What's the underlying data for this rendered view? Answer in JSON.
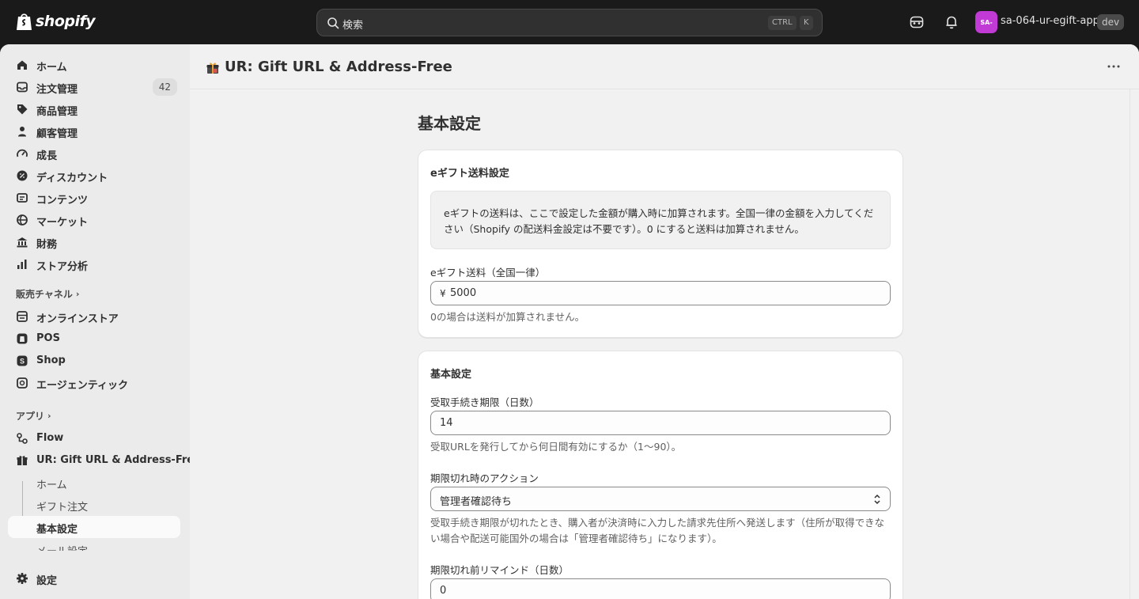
{
  "topbar": {
    "logo_text": "shopify",
    "search_placeholder": "検索",
    "shortcut_ctrl": "CTRL",
    "shortcut_k": "K",
    "avatar_initials": "SA-",
    "store_name": "sa-064-ur-egift-app",
    "env_badge": "dev",
    "avatar_color": "#c13ad6"
  },
  "sidebar": {
    "main_items": [
      {
        "label": "ホーム",
        "icon": "home-icon"
      },
      {
        "label": "注文管理",
        "icon": "orders-icon",
        "count": "42"
      },
      {
        "label": "商品管理",
        "icon": "tag-icon"
      },
      {
        "label": "顧客管理",
        "icon": "person-icon"
      },
      {
        "label": "成長",
        "icon": "gauge-icon"
      },
      {
        "label": "ディスカウント",
        "icon": "discount-icon"
      },
      {
        "label": "コンテンツ",
        "icon": "content-icon"
      },
      {
        "label": "マーケット",
        "icon": "globe-icon"
      },
      {
        "label": "財務",
        "icon": "bank-icon"
      },
      {
        "label": "ストア分析",
        "icon": "chart-icon"
      }
    ],
    "channels_heading": "販売チャネル",
    "channels": [
      {
        "label": "オンラインストア",
        "icon": "store-icon"
      },
      {
        "label": "POS",
        "icon": "pos-icon"
      },
      {
        "label": "Shop",
        "icon": "shop-icon"
      },
      {
        "label": "エージェンティック",
        "icon": "agentic-icon"
      }
    ],
    "apps_heading": "アプリ",
    "apps": [
      {
        "label": "Flow",
        "icon": "flow-icon"
      },
      {
        "label": "UR: Gift URL & Address-Free",
        "icon": "gift-icon"
      }
    ],
    "app_subitems": [
      "ホーム",
      "ギフト注文",
      "基本設定",
      "メール設定"
    ],
    "settings_label": "設定"
  },
  "header": {
    "app_title": "UR: Gift URL & Address-Free"
  },
  "page": {
    "title": "基本設定",
    "shipping_card": {
      "title": "eギフト送料設定",
      "info": "eギフトの送料は、ここで設定した金額が購入時に加算されます。全国一律の金額を入力してください（Shopify の配送料金設定は不要です）。0 にすると送料は加算されません。",
      "fee_label": "eギフト送料（全国一律）",
      "currency": "¥",
      "fee_value": "5000",
      "fee_help": "0の場合は送料が加算されません。"
    },
    "basic_card": {
      "title": "基本設定",
      "days_label": "受取手続き期限（日数）",
      "days_value": "14",
      "days_help": "受取URLを発行してから何日間有効にするか（1〜90）。",
      "action_label": "期限切れ時のアクション",
      "action_value": "管理者確認待ち",
      "action_help": "受取手続き期限が切れたとき、購入者が決済時に入力した請求先住所へ発送します（住所が取得できない場合や配送可能国外の場合は「管理者確認待ち」になります）。",
      "remind_label": "期限切れ前リマインド（日数）",
      "remind_value": "0"
    }
  }
}
